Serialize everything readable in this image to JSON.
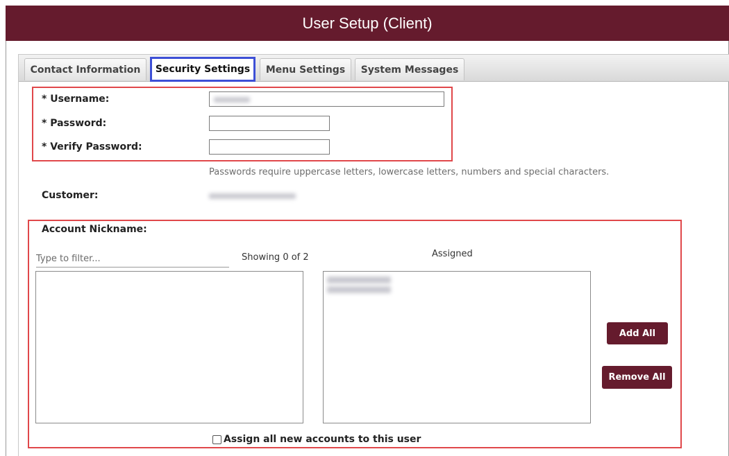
{
  "window": {
    "title": "User Setup (Client)"
  },
  "tabs": [
    {
      "label": "Contact Information",
      "active": false
    },
    {
      "label": "Security Settings",
      "active": true
    },
    {
      "label": "Menu Settings",
      "active": false
    },
    {
      "label": "System Messages",
      "active": false
    }
  ],
  "form": {
    "username_label": "* Username:",
    "password_label": "* Password:",
    "verify_password_label": "* Verify Password:",
    "password_hint": "Passwords require uppercase letters, lowercase letters, numbers and special characters.",
    "customer_label": "Customer:"
  },
  "accounts": {
    "section_label": "Account Nickname:",
    "filter_placeholder": "Type to filter...",
    "showing_text": "Showing 0 of 2",
    "assigned_label": "Assigned",
    "add_all_label": "Add All",
    "remove_all_label": "Remove All",
    "assign_all_new_label": "Assign all new accounts to this user",
    "assign_all_new_checked": false
  },
  "colors": {
    "header_bg": "#651b2d",
    "button_bg": "#651b2d",
    "highlight_red": "#e0474a",
    "highlight_blue": "#3d4fd6"
  }
}
